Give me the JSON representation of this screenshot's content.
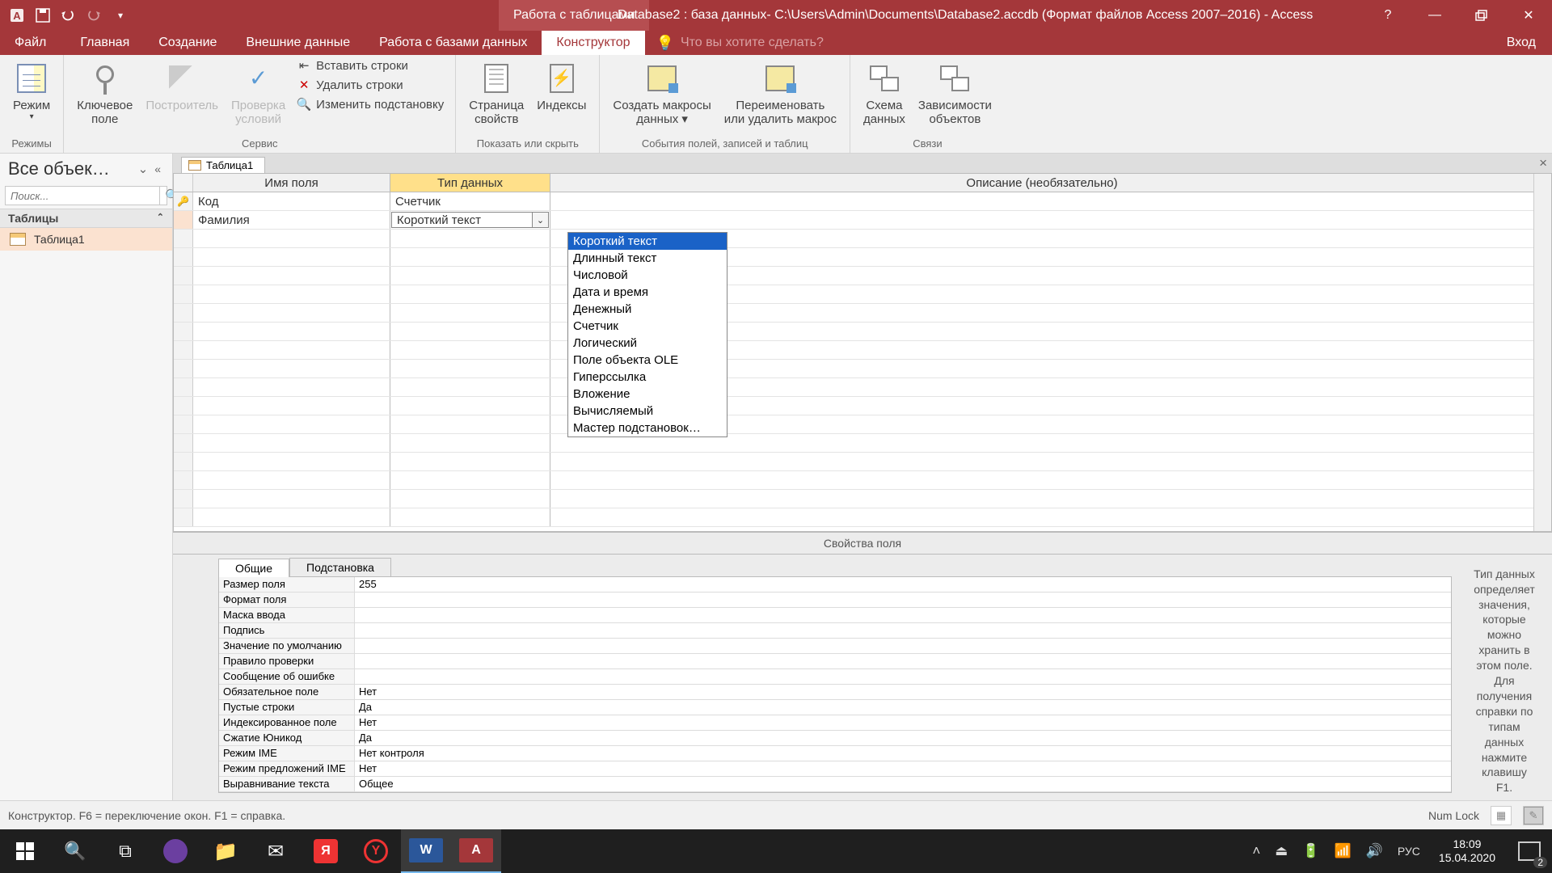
{
  "titlebar": {
    "context_tab": "Работа с таблицами",
    "title": "Database2 : база данных- C:\\Users\\Admin\\Documents\\Database2.accdb (Формат файлов Access 2007–2016) - Access"
  },
  "tabs": {
    "file": "Файл",
    "items": [
      "Главная",
      "Создание",
      "Внешние данные",
      "Работа с базами данных",
      "Конструктор"
    ],
    "active_index": 4,
    "tell_me": "Что вы хотите сделать?",
    "login": "Вход"
  },
  "ribbon": {
    "groups": {
      "modes": {
        "label": "Режимы",
        "view": "Режим"
      },
      "service": {
        "label": "Сервис",
        "key": "Ключевое\nполе",
        "builder": "Построитель",
        "validate": "Проверка\nусловий",
        "insert_rows": "Вставить строки",
        "delete_rows": "Удалить строки",
        "modify_lookup": "Изменить подстановку"
      },
      "show_hide": {
        "label": "Показать или скрыть",
        "prop_sheet": "Страница\nсвойств",
        "indexes": "Индексы"
      },
      "events": {
        "label": "События полей, записей и таблиц",
        "create_macro": "Создать макросы\nданных ▾",
        "rename_macro": "Переименовать\nили удалить макрос"
      },
      "relations": {
        "label": "Связи",
        "schema": "Схема\nданных",
        "deps": "Зависимости\nобъектов"
      }
    }
  },
  "nav": {
    "title": "Все объек…",
    "search_ph": "Поиск...",
    "group": "Таблицы",
    "item": "Таблица1"
  },
  "doc_tab": "Таблица1",
  "grid": {
    "headers": {
      "name": "Имя поля",
      "type": "Тип данных",
      "desc": "Описание (необязательно)"
    },
    "rows": [
      {
        "name": "Код",
        "type": "Счетчик",
        "key": true
      },
      {
        "name": "Фамилия",
        "type": "Короткий текст",
        "combo": true
      }
    ],
    "dropdown": [
      "Короткий текст",
      "Длинный текст",
      "Числовой",
      "Дата и время",
      "Денежный",
      "Счетчик",
      "Логический",
      "Поле объекта OLE",
      "Гиперссылка",
      "Вложение",
      "Вычисляемый",
      "Мастер подстановок…"
    ],
    "dropdown_selected": 0
  },
  "props": {
    "title": "Свойства поля",
    "tabs": [
      "Общие",
      "Подстановка"
    ],
    "rows": [
      {
        "n": "Размер поля",
        "v": "255"
      },
      {
        "n": "Формат поля",
        "v": ""
      },
      {
        "n": "Маска ввода",
        "v": ""
      },
      {
        "n": "Подпись",
        "v": ""
      },
      {
        "n": "Значение по умолчанию",
        "v": ""
      },
      {
        "n": "Правило проверки",
        "v": ""
      },
      {
        "n": "Сообщение об ошибке",
        "v": ""
      },
      {
        "n": "Обязательное поле",
        "v": "Нет"
      },
      {
        "n": "Пустые строки",
        "v": "Да"
      },
      {
        "n": "Индексированное поле",
        "v": "Нет"
      },
      {
        "n": "Сжатие Юникод",
        "v": "Да"
      },
      {
        "n": "Режим IME",
        "v": "Нет контроля"
      },
      {
        "n": "Режим предложений IME",
        "v": "Нет"
      },
      {
        "n": "Выравнивание текста",
        "v": "Общее"
      }
    ],
    "help": "Тип данных определяет значения, которые можно хранить в этом поле. Для получения справки по типам данных нажмите клавишу F1."
  },
  "status": {
    "left": "Конструктор.  F6 = переключение окон.  F1 = справка.",
    "numlock": "Num Lock"
  },
  "taskbar": {
    "lang": "РУС",
    "time": "18:09",
    "date": "15.04.2020",
    "notif_count": "2"
  }
}
